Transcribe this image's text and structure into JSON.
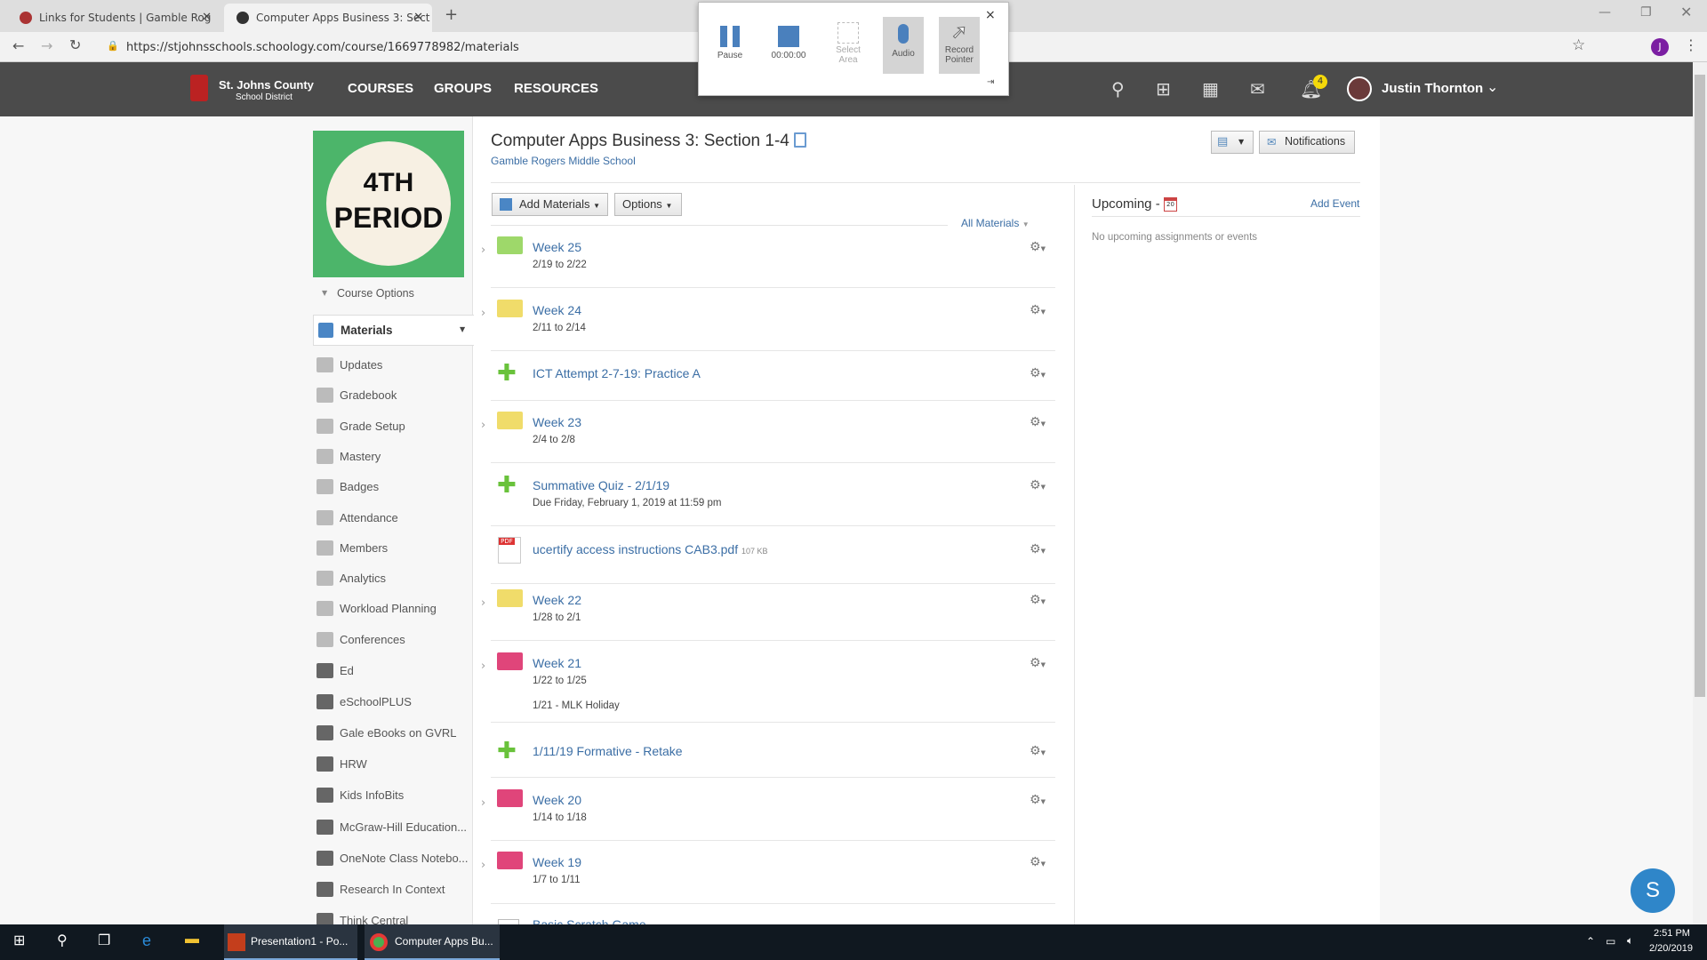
{
  "browser": {
    "tabs": [
      {
        "label": "Links for Students | Gamble Rog",
        "active": false
      },
      {
        "label": "Computer Apps Business 3: Sect",
        "active": true
      }
    ],
    "new_tab": "+",
    "url": "https://stjohnsschools.schoology.com/course/1669778982/materials",
    "profile_initial": "J"
  },
  "recorder": {
    "pause": "Pause",
    "timer": "00:00:00",
    "select_area": "Select Area",
    "audio": "Audio",
    "record_pointer": "Record Pointer",
    "close": "×"
  },
  "nav": {
    "logo_line1": "St. Johns County",
    "logo_line2": "School District",
    "links": [
      "COURSES",
      "GROUPS",
      "RESOURCES"
    ],
    "notif_count": "4",
    "user": "Justin Thornton"
  },
  "course": {
    "image_line1": "4TH",
    "image_line2": "PERIOD",
    "title": "Computer Apps Business 3: Section 1-4",
    "school": "Gamble Rogers Middle School",
    "course_options": "Course Options",
    "notifications_btn": "Notifications",
    "add_materials": "Add Materials",
    "options": "Options",
    "filter": "All Materials"
  },
  "sidebar": {
    "items": [
      "Materials",
      "Updates",
      "Gradebook",
      "Grade Setup",
      "Mastery",
      "Badges",
      "Attendance",
      "Members",
      "Analytics",
      "Workload Planning",
      "Conferences",
      "Ed",
      "eSchoolPLUS",
      "Gale eBooks on GVRL",
      "HRW",
      "Kids InfoBits",
      "McGraw-Hill Education...",
      "OneNote Class Notebo...",
      "Research In Context",
      "Think Central"
    ]
  },
  "materials": [
    {
      "type": "folder",
      "color": "#9ed86a",
      "title": "Week 25",
      "sub": "2/19 to 2/22"
    },
    {
      "type": "folder",
      "color": "#f0dc6a",
      "title": "Week 24",
      "sub": "2/11 to 2/14"
    },
    {
      "type": "assessment",
      "title": "ICT Attempt 2-7-19: Practice A"
    },
    {
      "type": "folder",
      "color": "#f0dc6a",
      "title": "Week 23",
      "sub": "2/4 to 2/8"
    },
    {
      "type": "assessment",
      "title": "Summative Quiz - 2/1/19",
      "sub": "Due Friday, February 1, 2019 at 11:59 pm"
    },
    {
      "type": "pdf",
      "title": "ucertify access instructions CAB3.pdf",
      "size": "107 KB"
    },
    {
      "type": "folder",
      "color": "#f0dc6a",
      "title": "Week 22",
      "sub": "1/28 to 2/1"
    },
    {
      "type": "folder",
      "color": "#e0457a",
      "title": "Week 21",
      "sub": "1/22 to 1/25",
      "note": "1/21 - MLK Holiday"
    },
    {
      "type": "assessment",
      "title": "1/11/19 Formative - Retake"
    },
    {
      "type": "folder",
      "color": "#e0457a",
      "title": "Week 20",
      "sub": "1/14 to 1/18"
    },
    {
      "type": "folder",
      "color": "#e0457a",
      "title": "Week 19",
      "sub": "1/7 to 1/11"
    },
    {
      "type": "page",
      "title": "Basic Scratch Game"
    }
  ],
  "upcoming": {
    "title": "Upcoming -",
    "cal_day": "20",
    "add_event": "Add Event",
    "empty": "No upcoming assignments or events"
  },
  "taskbar": {
    "apps": [
      "Presentation1 - Po...",
      "Computer Apps Bu..."
    ],
    "time": "2:51 PM",
    "date": "2/20/2019"
  },
  "chat_button": "S"
}
